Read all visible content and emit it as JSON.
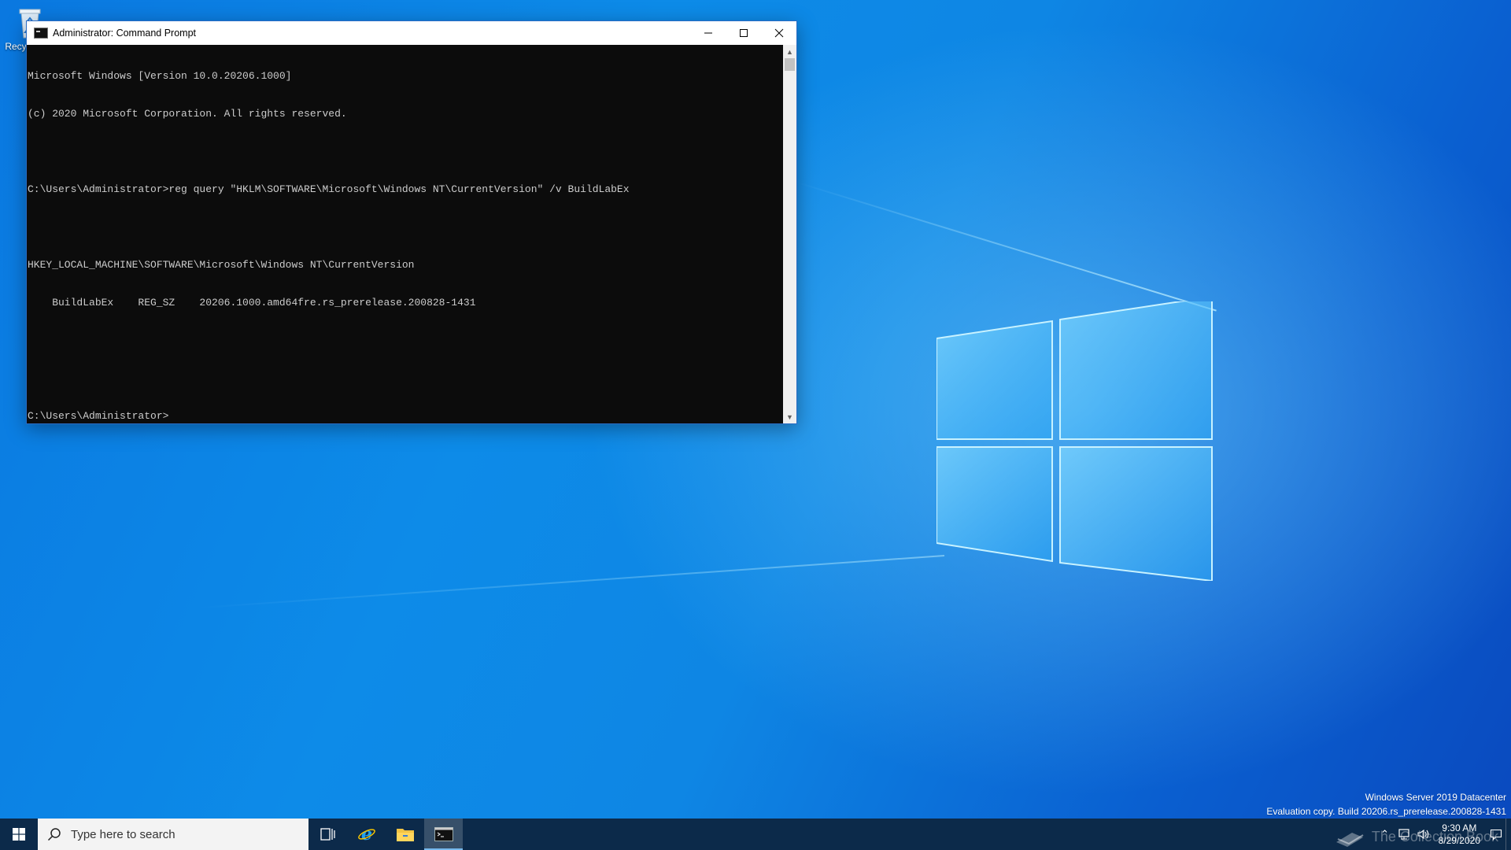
{
  "desktop": {
    "recycle_bin_label": "Recycle Bin"
  },
  "cmd_window": {
    "title": "Administrator: Command Prompt",
    "controls": [
      "minimize",
      "maximize",
      "close"
    ],
    "lines": [
      "Microsoft Windows [Version 10.0.20206.1000]",
      "(c) 2020 Microsoft Corporation. All rights reserved.",
      "",
      "C:\\Users\\Administrator>reg query \"HKLM\\SOFTWARE\\Microsoft\\Windows NT\\CurrentVersion\" /v BuildLabEx",
      "",
      "HKEY_LOCAL_MACHINE\\SOFTWARE\\Microsoft\\Windows NT\\CurrentVersion",
      "    BuildLabEx    REG_SZ    20206.1000.amd64fre.rs_prerelease.200828-1431",
      "",
      "",
      "C:\\Users\\Administrator>"
    ]
  },
  "watermark": {
    "line1": "Windows Server 2019 Datacenter",
    "line2": "Evaluation copy. Build 20206.rs_prerelease.200828-1431"
  },
  "taskbar": {
    "search_placeholder": "Type here to search",
    "pinned": [
      "task-view-icon",
      "internet-explorer-icon",
      "file-explorer-icon",
      "command-prompt-icon"
    ],
    "clock_time": "9:30 AM",
    "clock_date": "8/29/2020",
    "overlay_text": "The Collection Book"
  },
  "colors": {
    "console_bg": "#0c0c0c",
    "console_text": "#cccccc",
    "taskbar_bg": "#0c2a4a"
  }
}
